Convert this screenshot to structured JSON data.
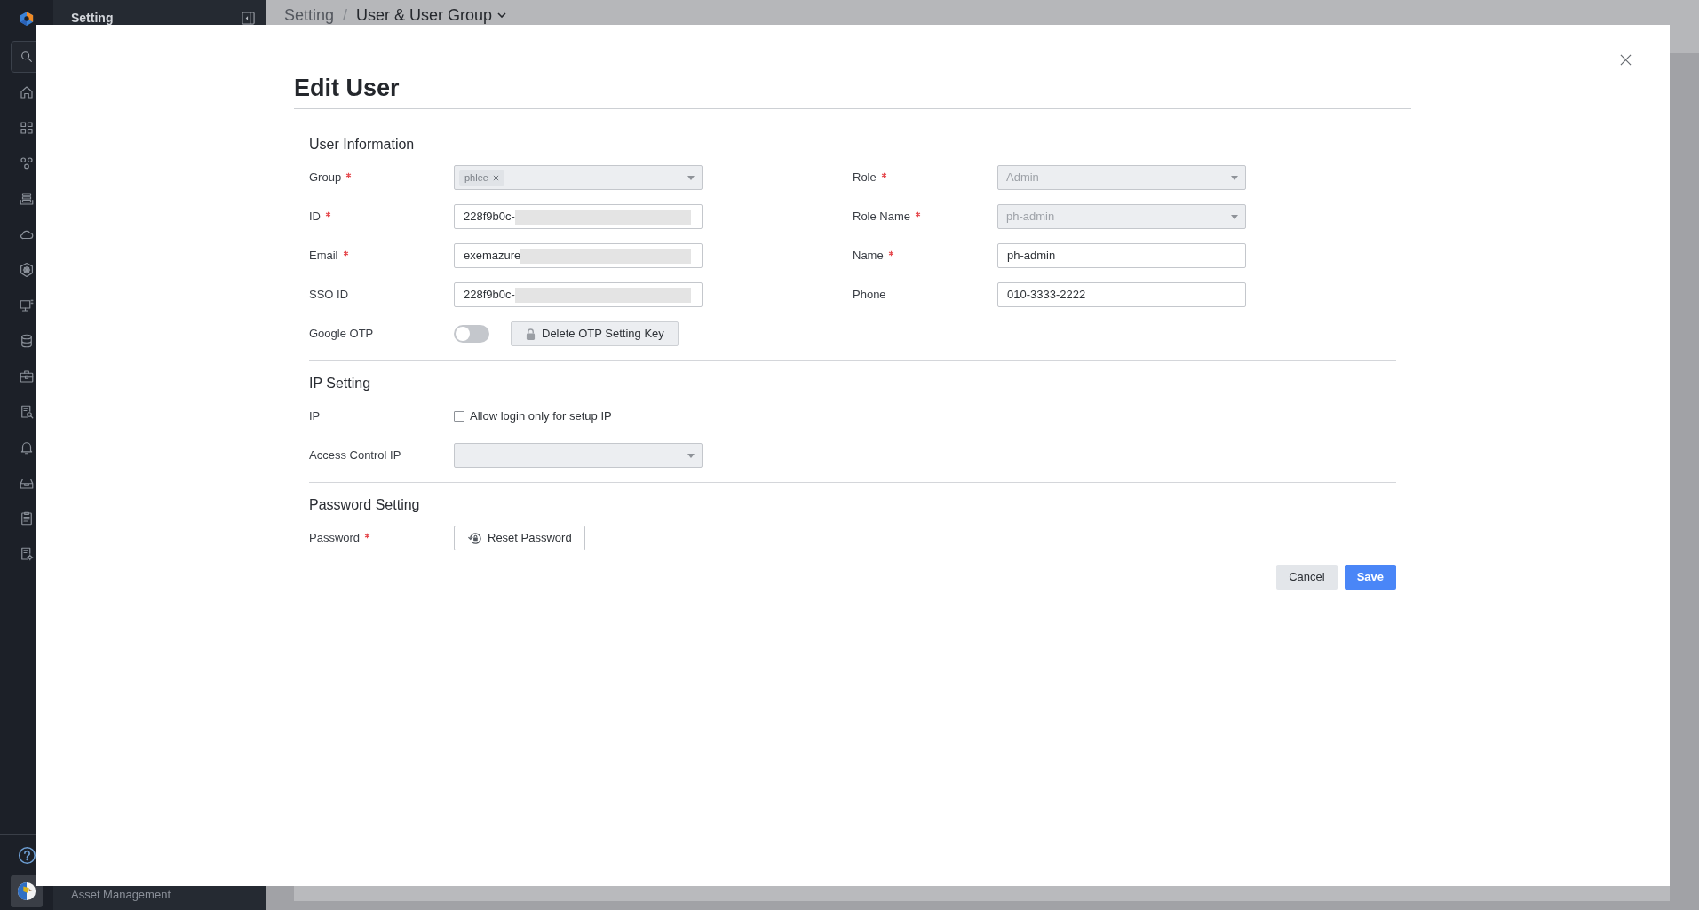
{
  "side_panel": {
    "title": "Setting",
    "menu_items": [
      {
        "label": "Asset Management"
      }
    ]
  },
  "breadcrumb": {
    "items": [
      {
        "label": "Setting",
        "dropdown": false
      },
      {
        "label": "User & User Group",
        "dropdown": true
      }
    ],
    "separator": "/"
  },
  "dialog": {
    "title": "Edit User",
    "sections": [
      {
        "title": "User Information",
        "columns": [
          {
            "fields": [
              {
                "label": "Group",
                "required": true,
                "kind": "multiselect",
                "disabled": true,
                "tags": [
                  "phlee"
                ]
              },
              {
                "label": "ID",
                "required": true,
                "kind": "text",
                "value": "228f9b0c-",
                "redacted": true
              },
              {
                "label": "Email",
                "required": true,
                "kind": "text",
                "value": "exemazure",
                "redacted": true
              },
              {
                "label": "SSO ID",
                "required": false,
                "kind": "text",
                "value": "228f9b0c-",
                "redacted": true
              },
              {
                "label": "Google OTP",
                "required": false,
                "kind": "toggle",
                "on": false,
                "action": {
                  "label": "Delete OTP Setting Key",
                  "disabled": true
                }
              }
            ]
          },
          {
            "fields": [
              {
                "label": "Role",
                "required": true,
                "kind": "select",
                "disabled": true,
                "value": "Admin"
              },
              {
                "label": "Role Name",
                "required": true,
                "kind": "select",
                "disabled": true,
                "value": "ph-admin"
              },
              {
                "label": "Name",
                "required": true,
                "kind": "text",
                "value": "ph-admin",
                "redacted": false
              },
              {
                "label": "Phone",
                "required": false,
                "kind": "text",
                "value": "010-3333-2222",
                "redacted": false
              }
            ]
          }
        ]
      },
      {
        "title": "IP Setting",
        "columns": [
          {
            "fields": [
              {
                "label": "IP",
                "required": false,
                "kind": "checkbox",
                "checked": false,
                "text": "Allow login only for setup IP"
              },
              {
                "label": "Access Control IP",
                "required": false,
                "kind": "select",
                "disabled": true
              }
            ]
          }
        ]
      },
      {
        "title": "Password Setting",
        "columns": [
          {
            "fields": [
              {
                "label": "Password",
                "required": true,
                "kind": "reset",
                "button": "Reset Password"
              }
            ]
          }
        ]
      }
    ],
    "buttons": [
      {
        "label": "Cancel",
        "kind": "cancel"
      },
      {
        "label": "Save",
        "kind": "submit"
      }
    ]
  }
}
